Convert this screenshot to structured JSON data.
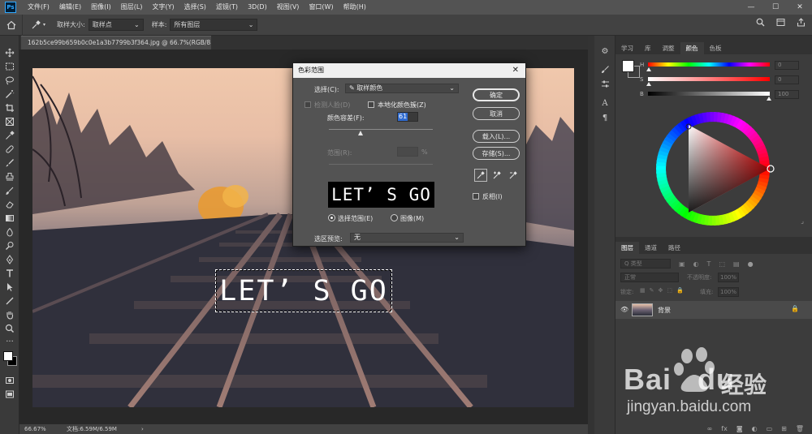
{
  "app": {
    "logo": "Ps",
    "menu": [
      "文件(F)",
      "编辑(E)",
      "图像(I)",
      "图层(L)",
      "文字(Y)",
      "选择(S)",
      "滤镜(T)",
      "3D(D)",
      "视图(V)",
      "窗口(W)",
      "帮助(H)"
    ],
    "window_controls": [
      "—",
      "☐",
      "✕"
    ]
  },
  "options_bar": {
    "sample_size_label": "取样大小:",
    "sample_size_value": "取样点",
    "sample_label": "样本:",
    "sample_value": "所有图层"
  },
  "document": {
    "tab_title": "162b5ce99b659b0c0e1a3b7799b3f364.jpg @ 66.7%(RGB/8#) *",
    "zoom": "66.67%",
    "doc_info": "文档:6.59M/6.59M",
    "canvas_text": "LET’ S GO"
  },
  "color_panel": {
    "tabs": [
      "学习",
      "库",
      "调整",
      "颜色",
      "色板"
    ],
    "active_tab": "颜色",
    "channels": [
      {
        "label": "H",
        "value": "0"
      },
      {
        "label": "S",
        "value": "0"
      },
      {
        "label": "B",
        "value": "100"
      }
    ]
  },
  "layers_panel": {
    "tabs": [
      "图层",
      "通道",
      "路径"
    ],
    "active_tab": "图层",
    "filter_placeholder": "Q 类型",
    "blend_mode": "正常",
    "opacity_label": "不透明度:",
    "opacity_value": "100%",
    "lock_label": "锁定:",
    "fill_label": "填充:",
    "fill_value": "100%",
    "layer_name": "背景"
  },
  "dialog": {
    "title": "色彩范围",
    "select_label": "选择(C):",
    "select_value": "✎ 取样颜色",
    "detect_faces": "检测人脸(D)",
    "localized": "本地化颜色簇(Z)",
    "fuzziness_label": "颜色容差(F):",
    "fuzziness_value": "61",
    "range_label": "范围(R):",
    "range_unit": "%",
    "preview_text": "LET’ S GO",
    "selection_radio": "选择范围(E)",
    "image_radio": "图像(M)",
    "preview_label": "选区预览:",
    "preview_value": "无",
    "ok": "确定",
    "cancel": "取消",
    "load": "载入(L)...",
    "save": "存储(S)...",
    "invert": "反相(I)"
  },
  "watermark": {
    "brand": "Bai",
    "brand2": "du",
    "cn": "经验",
    "url": "jingyan.baidu.com"
  }
}
